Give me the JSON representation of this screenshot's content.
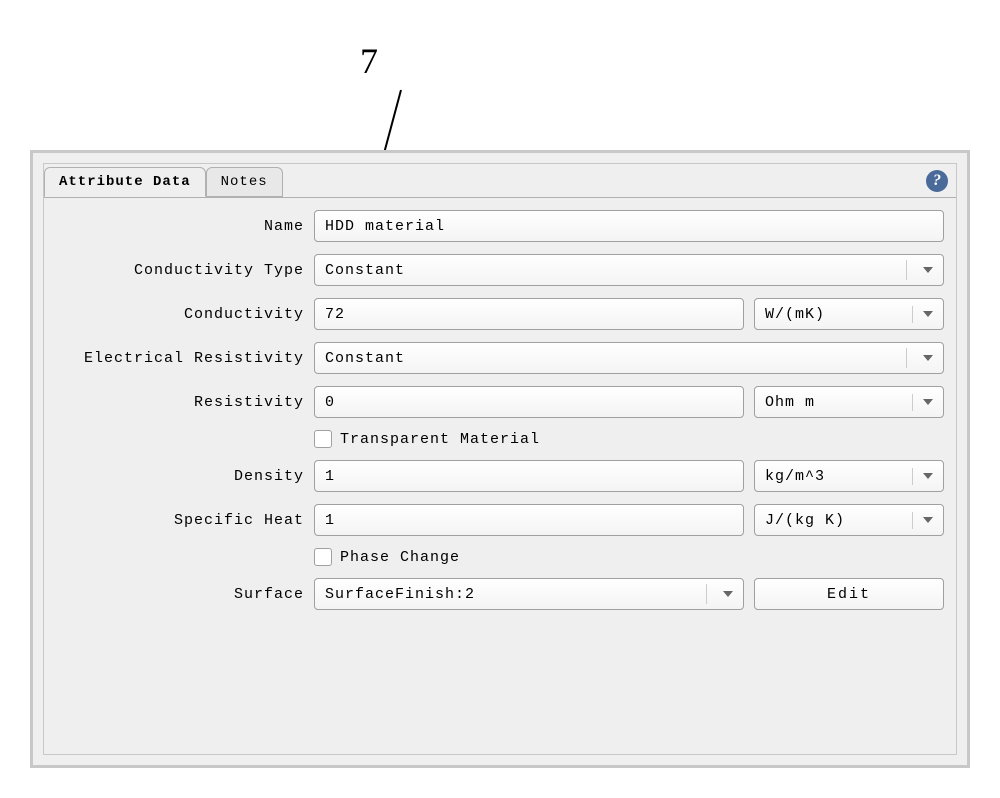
{
  "annotation": {
    "label": "7"
  },
  "tabs": {
    "attribute_data": "Attribute Data",
    "notes": "Notes"
  },
  "help_icon": "?",
  "form": {
    "name": {
      "label": "Name",
      "value": "HDD material"
    },
    "conductivity_type": {
      "label": "Conductivity Type",
      "value": "Constant"
    },
    "conductivity": {
      "label": "Conductivity",
      "value": "72",
      "unit": "W/(mK)"
    },
    "electrical_resistivity": {
      "label": "Electrical Resistivity",
      "value": "Constant"
    },
    "resistivity": {
      "label": "Resistivity",
      "value": "0",
      "unit": "Ohm m"
    },
    "transparent_material": {
      "label": "Transparent Material"
    },
    "density": {
      "label": "Density",
      "value": "1",
      "unit": "kg/m^3"
    },
    "specific_heat": {
      "label": "Specific Heat",
      "value": "1",
      "unit": "J/(kg K)"
    },
    "phase_change": {
      "label": "Phase Change"
    },
    "surface": {
      "label": "Surface",
      "value": "SurfaceFinish:2",
      "edit": "Edit"
    }
  }
}
